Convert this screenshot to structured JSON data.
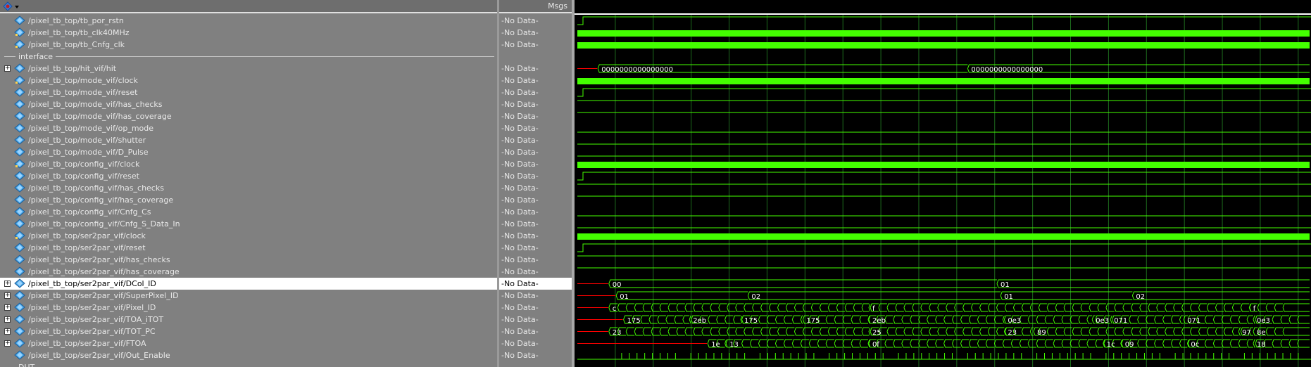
{
  "header": {
    "msgs_label": "Msgs"
  },
  "divider_label": "interface",
  "bottom_partial_label": "DUT",
  "signals": [
    {
      "name": "/pixel_tb_top/tb_por_rstn",
      "msg": "-No Data-",
      "expand": false,
      "type": "reset"
    },
    {
      "name": "/pixel_tb_top/tb_clk40MHz",
      "msg": "-No Data-",
      "expand": false,
      "type": "clock"
    },
    {
      "name": "/pixel_tb_top/tb_Cnfg_clk",
      "msg": "-No Data-",
      "expand": false,
      "type": "clock"
    },
    {
      "divider": true
    },
    {
      "name": "/pixel_tb_top/hit_vif/hit",
      "msg": "-No Data-",
      "expand": true,
      "type": "bus",
      "values": [
        {
          "t": 0.03,
          "v": "0000000000000000"
        },
        {
          "t": 0.535,
          "v": "0000000000000000"
        }
      ]
    },
    {
      "name": "/pixel_tb_top/mode_vif/clock",
      "msg": "-No Data-",
      "expand": false,
      "type": "clock"
    },
    {
      "name": "/pixel_tb_top/mode_vif/reset",
      "msg": "-No Data-",
      "expand": false,
      "type": "reset"
    },
    {
      "name": "/pixel_tb_top/mode_vif/has_checks",
      "msg": "-No Data-",
      "expand": false,
      "type": "high"
    },
    {
      "name": "/pixel_tb_top/mode_vif/has_coverage",
      "msg": "-No Data-",
      "expand": false,
      "type": "high"
    },
    {
      "name": "/pixel_tb_top/mode_vif/op_mode",
      "msg": "-No Data-",
      "expand": false,
      "type": "low"
    },
    {
      "name": "/pixel_tb_top/mode_vif/shutter",
      "msg": "-No Data-",
      "expand": false,
      "type": "low"
    },
    {
      "name": "/pixel_tb_top/mode_vif/D_Pulse",
      "msg": "-No Data-",
      "expand": false,
      "type": "low"
    },
    {
      "name": "/pixel_tb_top/config_vif/clock",
      "msg": "-No Data-",
      "expand": false,
      "type": "clock"
    },
    {
      "name": "/pixel_tb_top/config_vif/reset",
      "msg": "-No Data-",
      "expand": false,
      "type": "reset"
    },
    {
      "name": "/pixel_tb_top/config_vif/has_checks",
      "msg": "-No Data-",
      "expand": false,
      "type": "high"
    },
    {
      "name": "/pixel_tb_top/config_vif/has_coverage",
      "msg": "-No Data-",
      "expand": false,
      "type": "high"
    },
    {
      "name": "/pixel_tb_top/config_vif/Cnfg_Cs",
      "msg": "-No Data-",
      "expand": false,
      "type": "low"
    },
    {
      "name": "/pixel_tb_top/config_vif/Cnfg_S_Data_In",
      "msg": "-No Data-",
      "expand": false,
      "type": "low"
    },
    {
      "name": "/pixel_tb_top/ser2par_vif/clock",
      "msg": "-No Data-",
      "expand": false,
      "type": "clock"
    },
    {
      "name": "/pixel_tb_top/ser2par_vif/reset",
      "msg": "-No Data-",
      "expand": false,
      "type": "reset"
    },
    {
      "name": "/pixel_tb_top/ser2par_vif/has_checks",
      "msg": "-No Data-",
      "expand": false,
      "type": "high"
    },
    {
      "name": "/pixel_tb_top/ser2par_vif/has_coverage",
      "msg": "-No Data-",
      "expand": false,
      "type": "high"
    },
    {
      "name": "/pixel_tb_top/ser2par_vif/DCol_ID",
      "msg": "-No Data-",
      "expand": true,
      "type": "bus",
      "selected": true,
      "values": [
        {
          "t": 0.045,
          "v": "00"
        },
        {
          "t": 0.575,
          "v": "01"
        }
      ]
    },
    {
      "name": "/pixel_tb_top/ser2par_vif/SuperPixel_ID",
      "msg": "-No Data-",
      "expand": true,
      "type": "bus",
      "values": [
        {
          "t": 0.055,
          "v": "01"
        },
        {
          "t": 0.235,
          "v": "02"
        },
        {
          "t": 0.58,
          "v": "01"
        },
        {
          "t": 0.76,
          "v": "02"
        }
      ]
    },
    {
      "name": "/pixel_tb_top/ser2par_vif/Pixel_ID",
      "msg": "-No Data-",
      "expand": true,
      "type": "bus",
      "values": [
        {
          "t": 0.045,
          "v": "c"
        },
        {
          "t": 0.4,
          "v": "f"
        },
        {
          "t": 0.92,
          "v": "f"
        }
      ]
    },
    {
      "name": "/pixel_tb_top/ser2par_vif/TOA_iTOT",
      "msg": "-No Data-",
      "expand": true,
      "type": "bus",
      "values": [
        {
          "t": 0.065,
          "v": "175"
        },
        {
          "t": 0.155,
          "v": "2eb"
        },
        {
          "t": 0.225,
          "v": "175"
        },
        {
          "t": 0.31,
          "v": "175"
        },
        {
          "t": 0.4,
          "v": "2eb"
        },
        {
          "t": 0.585,
          "v": "0e3"
        },
        {
          "t": 0.705,
          "v": "0e3"
        },
        {
          "t": 0.73,
          "v": "071"
        },
        {
          "t": 0.83,
          "v": "071"
        },
        {
          "t": 0.925,
          "v": "0e3"
        }
      ]
    },
    {
      "name": "/pixel_tb_top/ser2par_vif/TOT_PC",
      "msg": "-No Data-",
      "expand": true,
      "type": "bus",
      "values": [
        {
          "t": 0.045,
          "v": "23"
        },
        {
          "t": 0.4,
          "v": "25"
        },
        {
          "t": 0.585,
          "v": "23"
        },
        {
          "t": 0.625,
          "v": "89"
        },
        {
          "t": 0.905,
          "v": "97"
        },
        {
          "t": 0.925,
          "v": "8e"
        }
      ]
    },
    {
      "name": "/pixel_tb_top/ser2par_vif/FTOA",
      "msg": "-No Data-",
      "expand": true,
      "type": "bus",
      "values": [
        {
          "t": 0.18,
          "v": "1e"
        },
        {
          "t": 0.205,
          "v": "13"
        },
        {
          "t": 0.4,
          "v": "0f"
        },
        {
          "t": 0.72,
          "v": "1c"
        },
        {
          "t": 0.745,
          "v": "09"
        },
        {
          "t": 0.835,
          "v": "0c"
        },
        {
          "t": 0.925,
          "v": "18"
        }
      ]
    },
    {
      "name": "/pixel_tb_top/ser2par_vif/Out_Enable",
      "msg": "-No Data-",
      "expand": false,
      "type": "pulses"
    }
  ],
  "colors": {
    "wave": "#44ff00",
    "grid": "#1d6b1d",
    "panel": "#808080",
    "bus_x": "#ff0000"
  }
}
